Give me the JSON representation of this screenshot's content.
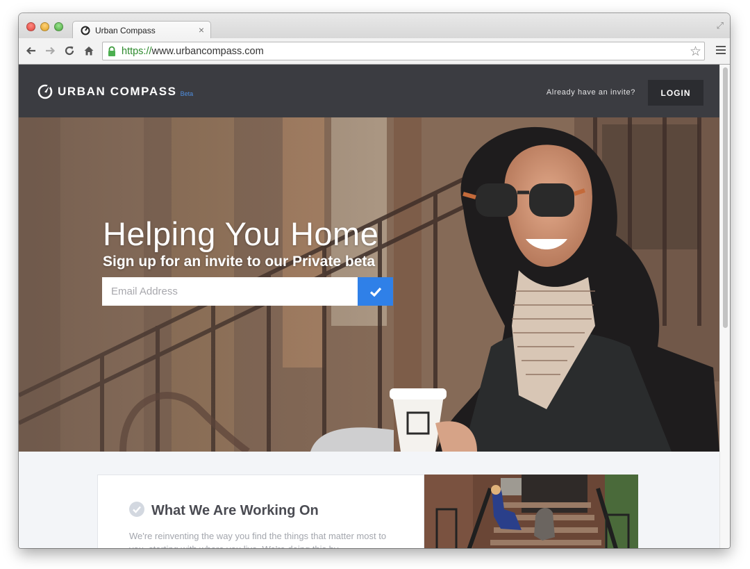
{
  "browser": {
    "tab_title": "Urban Compass",
    "tab_close": "×",
    "url_protocol": "https://",
    "url_rest": "www.urbancompass.com"
  },
  "header": {
    "logo_text": "URBAN COMPASS",
    "logo_beta": "Beta",
    "invite_text": "Already have an invite?",
    "login_label": "LOGIN"
  },
  "hero": {
    "title": "Helping You Home",
    "subtitle": "Sign up for an invite to our Private beta",
    "email_placeholder": "Email Address"
  },
  "section": {
    "title": "What We Are Working On",
    "body": "We're reinventing the way you find the things that matter most to you, starting with where you live. We're doing this by"
  },
  "colors": {
    "header_bg": "#3b3c41",
    "accent_blue": "#2f80e8",
    "page_bg": "#f3f5f8"
  },
  "icons": [
    "back-arrow-icon",
    "forward-arrow-icon",
    "reload-icon",
    "home-icon",
    "lock-icon",
    "star-icon",
    "menu-icon",
    "compass-logo-icon",
    "checkmark-icon"
  ]
}
